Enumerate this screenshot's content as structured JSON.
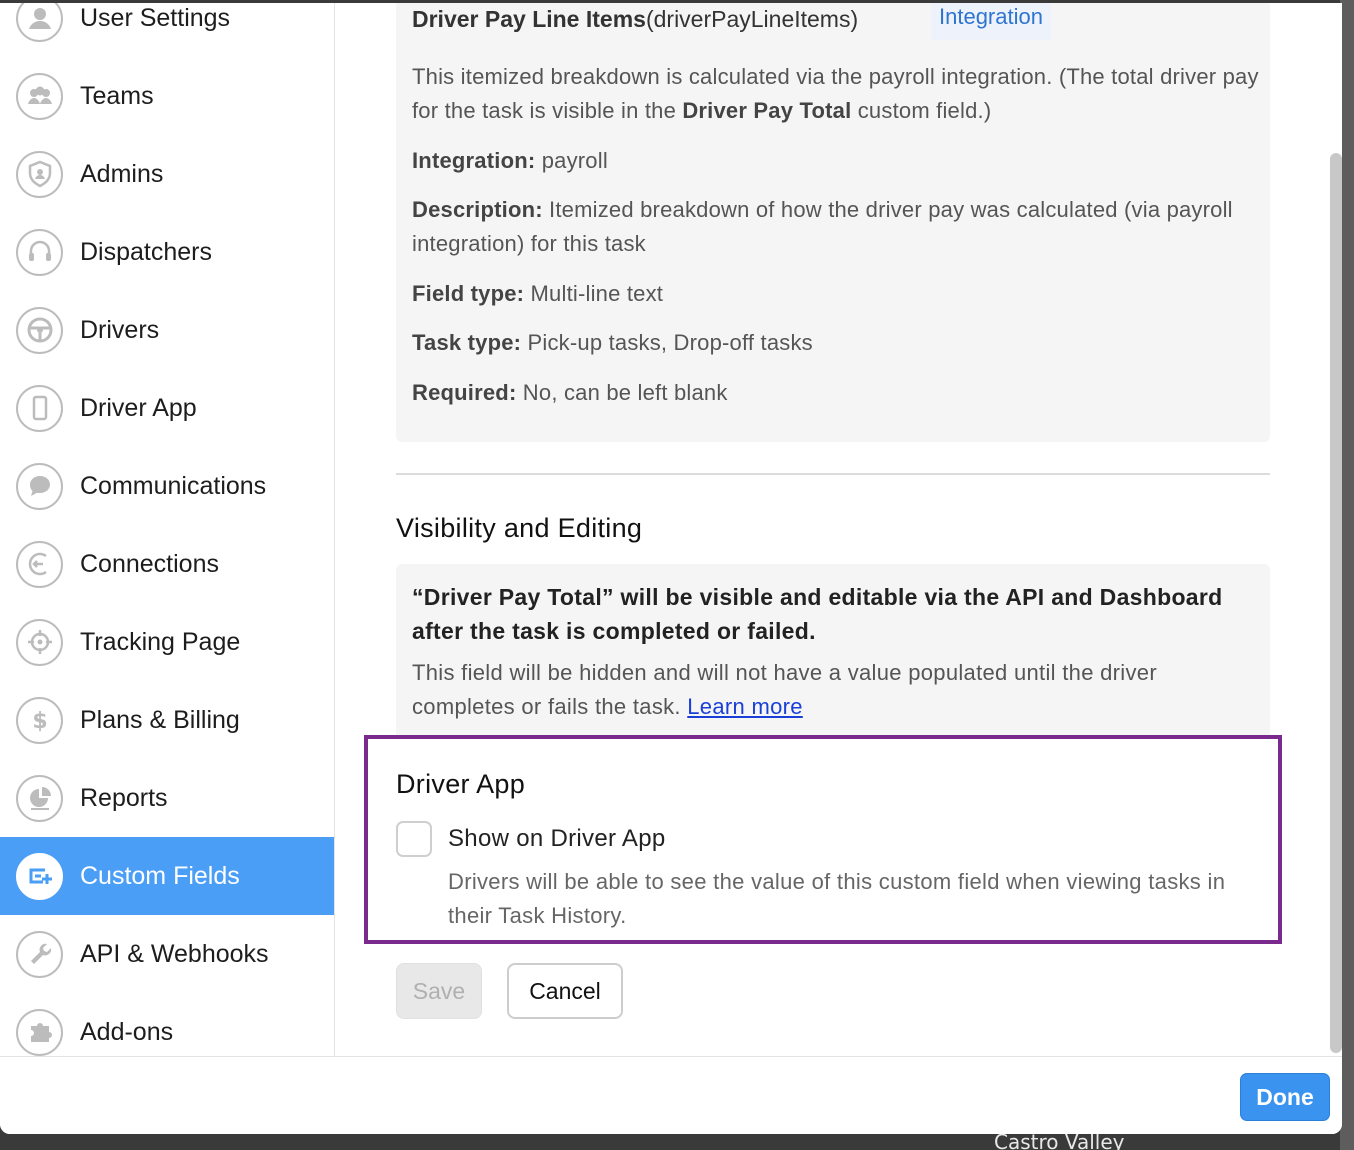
{
  "sidebar": {
    "items": [
      {
        "label": "User Settings",
        "icon": "user-icon"
      },
      {
        "label": "Teams",
        "icon": "teams-icon"
      },
      {
        "label": "Admins",
        "icon": "shield-icon"
      },
      {
        "label": "Dispatchers",
        "icon": "headset-icon"
      },
      {
        "label": "Drivers",
        "icon": "steering-wheel-icon"
      },
      {
        "label": "Driver App",
        "icon": "phone-icon"
      },
      {
        "label": "Communications",
        "icon": "chat-bubble-icon"
      },
      {
        "label": "Connections",
        "icon": "connections-icon"
      },
      {
        "label": "Tracking Page",
        "icon": "target-icon"
      },
      {
        "label": "Plans & Billing",
        "icon": "dollar-icon"
      },
      {
        "label": "Reports",
        "icon": "pie-chart-icon"
      },
      {
        "label": "Custom Fields",
        "icon": "custom-field-add-icon",
        "active": true
      },
      {
        "label": "API & Webhooks",
        "icon": "wrench-icon"
      },
      {
        "label": "Add-ons",
        "icon": "puzzle-icon"
      }
    ]
  },
  "info_card": {
    "title_bold": "Driver Pay Line Items",
    "title_key": "(driverPayLineItems)",
    "tag": "Integration",
    "intro_1": "This itemized breakdown is calculated via the payroll integration. (The total driver pay for the task is visible in the ",
    "intro_bold": "Driver Pay Total",
    "intro_2": " custom field.)",
    "integration_label": "Integration:",
    "integration_value": " payroll",
    "description_label": "Description:",
    "description_value": " Itemized breakdown of how the driver pay was calculated (via payroll integration) for this task",
    "field_type_label": "Field type:",
    "field_type_value": " Multi-line text",
    "task_type_label": "Task type:",
    "task_type_value": " Pick-up tasks, Drop-off tasks",
    "required_label": "Required:",
    "required_value": " No, can be left blank"
  },
  "visibility": {
    "heading": "Visibility and Editing",
    "bold_text": "“Driver Pay Total” will be visible and editable via the API and Dashboard after the task is completed or failed.",
    "text": "This field will be hidden and will not have a value populated until the driver completes or fails the task. ",
    "link": "Learn more"
  },
  "driver_app": {
    "heading": "Driver App",
    "checkbox_label": "Show on Driver App",
    "checkbox_checked": false,
    "description": "Drivers will be able to see the value of this custom field when viewing tasks in their Task History."
  },
  "actions": {
    "save": "Save",
    "cancel": "Cancel",
    "done": "Done"
  },
  "map": {
    "label": "Castro Valley"
  },
  "colors": {
    "accent": "#4a9ef5",
    "highlight_border": "#7a2a8c",
    "link": "#1a3fd6"
  }
}
